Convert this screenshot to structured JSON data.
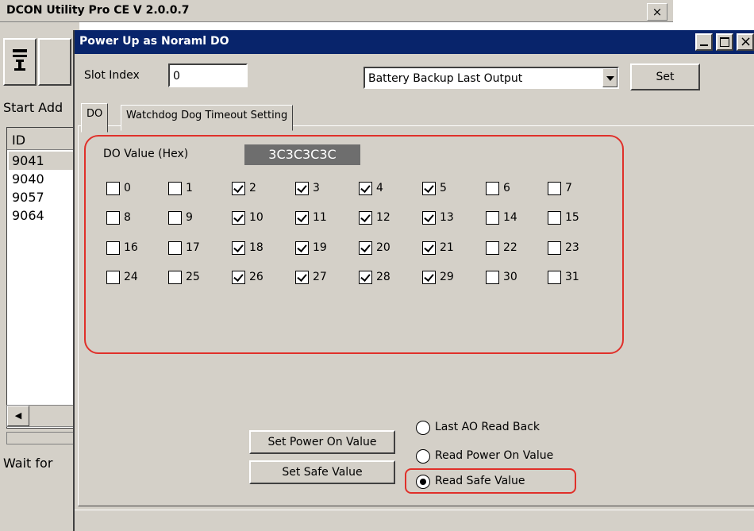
{
  "parent": {
    "title": "DCON Utility Pro CE V 2.0.0.7",
    "close": "×",
    "start_label": "Start Add",
    "list_header": "ID",
    "list_items": [
      "9041",
      "9040",
      "9057",
      "9064"
    ],
    "wait_text": "Wait for"
  },
  "dialog": {
    "title": "Power Up as Noraml DO",
    "slot_label": "Slot Index",
    "slot_value": "0",
    "mode_select": "Battery Backup Last Output",
    "set_label": "Set",
    "tabs": [
      "DO",
      "Watchdog Dog Timeout Setting"
    ],
    "do_value_label": "DO Value (Hex)",
    "do_value": "3C3C3C3C",
    "checkboxes": [
      {
        "label": "0",
        "checked": false
      },
      {
        "label": "1",
        "checked": false
      },
      {
        "label": "2",
        "checked": true
      },
      {
        "label": "3",
        "checked": true
      },
      {
        "label": "4",
        "checked": true
      },
      {
        "label": "5",
        "checked": true
      },
      {
        "label": "6",
        "checked": false
      },
      {
        "label": "7",
        "checked": false
      },
      {
        "label": "8",
        "checked": false
      },
      {
        "label": "9",
        "checked": false
      },
      {
        "label": "10",
        "checked": true
      },
      {
        "label": "11",
        "checked": true
      },
      {
        "label": "12",
        "checked": true
      },
      {
        "label": "13",
        "checked": true
      },
      {
        "label": "14",
        "checked": false
      },
      {
        "label": "15",
        "checked": false
      },
      {
        "label": "16",
        "checked": false
      },
      {
        "label": "17",
        "checked": false
      },
      {
        "label": "18",
        "checked": true
      },
      {
        "label": "19",
        "checked": true
      },
      {
        "label": "20",
        "checked": true
      },
      {
        "label": "21",
        "checked": true
      },
      {
        "label": "22",
        "checked": false
      },
      {
        "label": "23",
        "checked": false
      },
      {
        "label": "24",
        "checked": false
      },
      {
        "label": "25",
        "checked": false
      },
      {
        "label": "26",
        "checked": true
      },
      {
        "label": "27",
        "checked": true
      },
      {
        "label": "28",
        "checked": true
      },
      {
        "label": "29",
        "checked": true
      },
      {
        "label": "30",
        "checked": false
      },
      {
        "label": "31",
        "checked": false
      }
    ],
    "set_power_on_label": "Set Power On Value",
    "set_safe_label": "Set Safe Value",
    "radio_last": "Last AO Read Back",
    "radio_power": "Read Power On Value",
    "radio_safe": "Read Safe Value",
    "selected_radio": "radio_safe"
  },
  "colors": {
    "titlebar": "#08246b",
    "window_face": "#d4d0c8",
    "highlight": "#e0302a",
    "value_box": "#6e6e6e"
  }
}
